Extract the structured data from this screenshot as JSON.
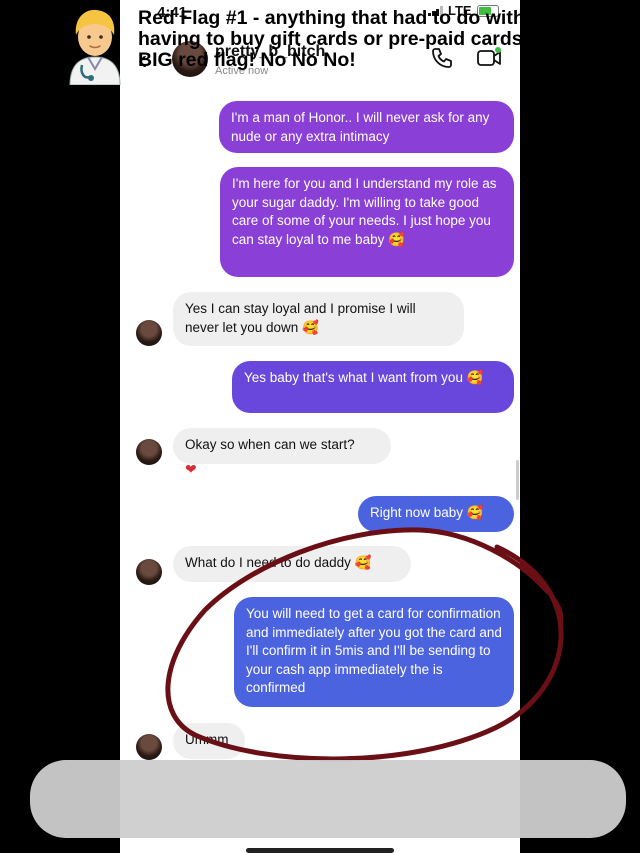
{
  "status_bar": {
    "time": "4:41",
    "network": "LTE"
  },
  "header": {
    "username": "pretty_b_bitch",
    "status": "Active now"
  },
  "messages": [
    {
      "text": "I'm a man of Honor.. I will never ask for any nude or any extra intimacy"
    },
    {
      "text": "I'm here for you and I understand my role as your sugar daddy. I'm willing to take good care of some of your needs. I just hope you can stay loyal to me baby 🥰"
    },
    {
      "text": "Yes I can stay loyal and I promise I will never let you down 🥰"
    },
    {
      "text": "Yes baby that's what I want from you 🥰"
    },
    {
      "text": "Okay so when can we start?"
    },
    {
      "text": "Right now baby 🥰"
    },
    {
      "text": "What do I need to do daddy 🥰"
    },
    {
      "text": "You will need to get a card for confirmation and immediately after you got the card and I'll confirm it in 5mis and I'll be sending to your cash app immediately the is confirmed"
    },
    {
      "text": "Ummm"
    }
  ],
  "reaction": "❤",
  "caption": "Red Flag #1 - anything that had to do with having to buy gift cards or pre-paid cards is a BIG red flag! No No No!",
  "colors": {
    "outgoing": "#8a3fd6",
    "outgoing_blue": "#4c63e0",
    "incoming": "#efefef",
    "annotation_circle": "#6b0f16"
  },
  "icons": [
    "back-arrow-icon",
    "phone-call-icon",
    "video-call-icon",
    "heart-reaction-icon",
    "person-emoji-icon"
  ]
}
